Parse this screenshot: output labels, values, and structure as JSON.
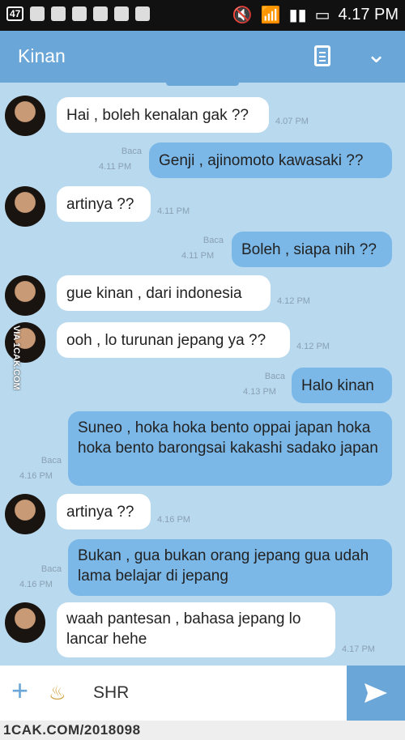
{
  "status_bar": {
    "notification_count": "47",
    "time": "4.17 PM",
    "icons": [
      "lock-icon",
      "pinterest-icon",
      "gallery-icon",
      "line-icon",
      "messenger-icon",
      "circle-icon",
      "mute-icon",
      "wifi-icon",
      "signal-icon",
      "signal-icon",
      "battery-icon"
    ]
  },
  "header": {
    "contact_name": "Kinan",
    "menu_icon": "document-icon",
    "collapse_icon": "chevron-down-icon"
  },
  "messages": [
    {
      "side": "in",
      "text": "Hai , boleh kenalan gak ??",
      "time": "4.07 PM"
    },
    {
      "side": "out",
      "read": "Baca",
      "time": "4.11 PM",
      "text": "Genji , ajinomoto kawasaki ??"
    },
    {
      "side": "in",
      "text": "artinya ??",
      "time": "4.11 PM"
    },
    {
      "side": "out",
      "read": "Baca",
      "time": "4.11 PM",
      "text": "Boleh , siapa nih ??"
    },
    {
      "side": "in",
      "text": "gue kinan , dari indonesia",
      "time": "4.12 PM"
    },
    {
      "side": "in",
      "text": "ooh , lo turunan jepang ya ??",
      "time": "4.12 PM"
    },
    {
      "side": "out",
      "read": "Baca",
      "time": "4.13 PM",
      "text": "Halo kinan"
    },
    {
      "side": "out",
      "read": "Baca",
      "time": "4.16 PM",
      "text": "Suneo , hoka hoka bento oppai japan hoka hoka bento barongsai kakashi sadako japan"
    },
    {
      "side": "in",
      "text": "artinya ??",
      "time": "4.16 PM"
    },
    {
      "side": "out",
      "read": "Baca",
      "time": "4.16 PM",
      "text": "Bukan , gua bukan orang jepang gua udah lama belajar di jepang"
    },
    {
      "side": "in",
      "text": "waah pantesan , bahasa jepang lo lancar hehe",
      "time": "4.17 PM"
    }
  ],
  "watermark": "VIA 1CAK.COM",
  "composer": {
    "add_icon": "plus-icon",
    "emoji_icon": "magic-lamp-icon",
    "input_value": "SHR",
    "send_icon": "send-icon"
  },
  "footer": {
    "text": "1CAK.COM/2018098"
  },
  "colors": {
    "header": "#6aa7d8",
    "background": "#b8d9ee",
    "outgoing": "#7bb8e8",
    "incoming": "#ffffff"
  }
}
